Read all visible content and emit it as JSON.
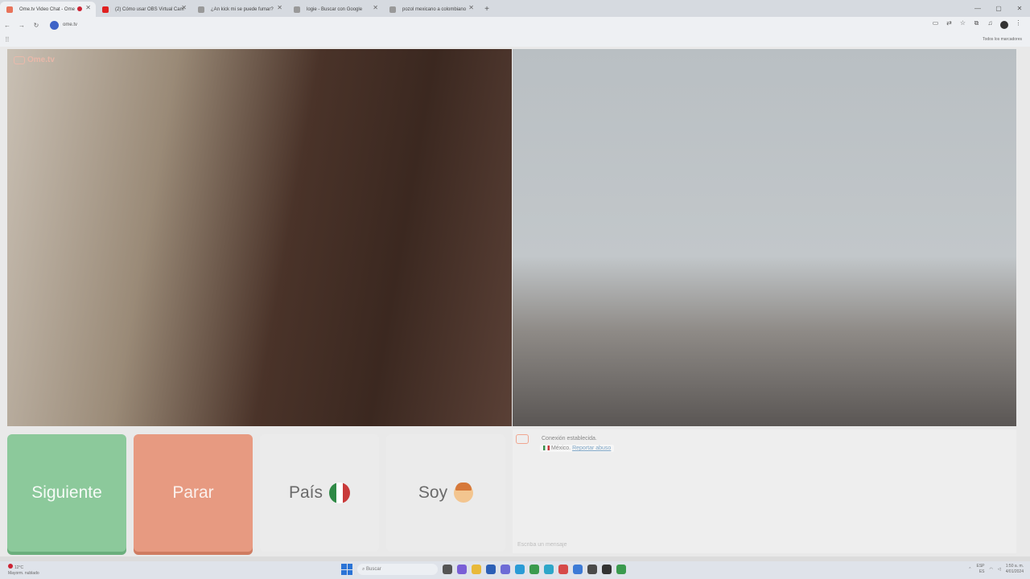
{
  "browser": {
    "tabs": [
      {
        "title": "Ome.tv Video Chat - Ome",
        "active": true,
        "favicon_color": "#e8735a",
        "recording": true
      },
      {
        "title": "(2) Cómo usar OBS Virtual Cam",
        "active": false,
        "favicon_color": "#e02020"
      },
      {
        "title": "¿An kick mi se puede fumar?",
        "active": false,
        "favicon_color": "#888888"
      },
      {
        "title": "logie - Buscar con Google",
        "active": false,
        "favicon_color": "#888888"
      },
      {
        "title": "pozol mexicano a colombiano",
        "active": false,
        "favicon_color": "#888888"
      }
    ],
    "url": "ome.tv",
    "bookmarks_all": "Todos los marcadores"
  },
  "app": {
    "logo_text": "Ome.tv",
    "buttons": {
      "next_label": "Siguiente",
      "stop_label": "Parar",
      "country_label": "País",
      "gender_label": "Soy"
    },
    "country_flag_colors": [
      "#2f8a46",
      "#ffffff",
      "#c93a3a"
    ],
    "chat": {
      "status_message": "Conexión establecida.",
      "country": "México.",
      "report_link": "Reportar abuso",
      "input_placeholder": "Escriba un mensaje"
    }
  },
  "taskbar": {
    "weather_temp": "12°C",
    "weather_desc": "Mayorm. nublado",
    "search_placeholder": "Buscar",
    "lang_code": "ESP",
    "lang_sub": "ES",
    "time": "1:50 a. m.",
    "date": "4/01/2024"
  }
}
